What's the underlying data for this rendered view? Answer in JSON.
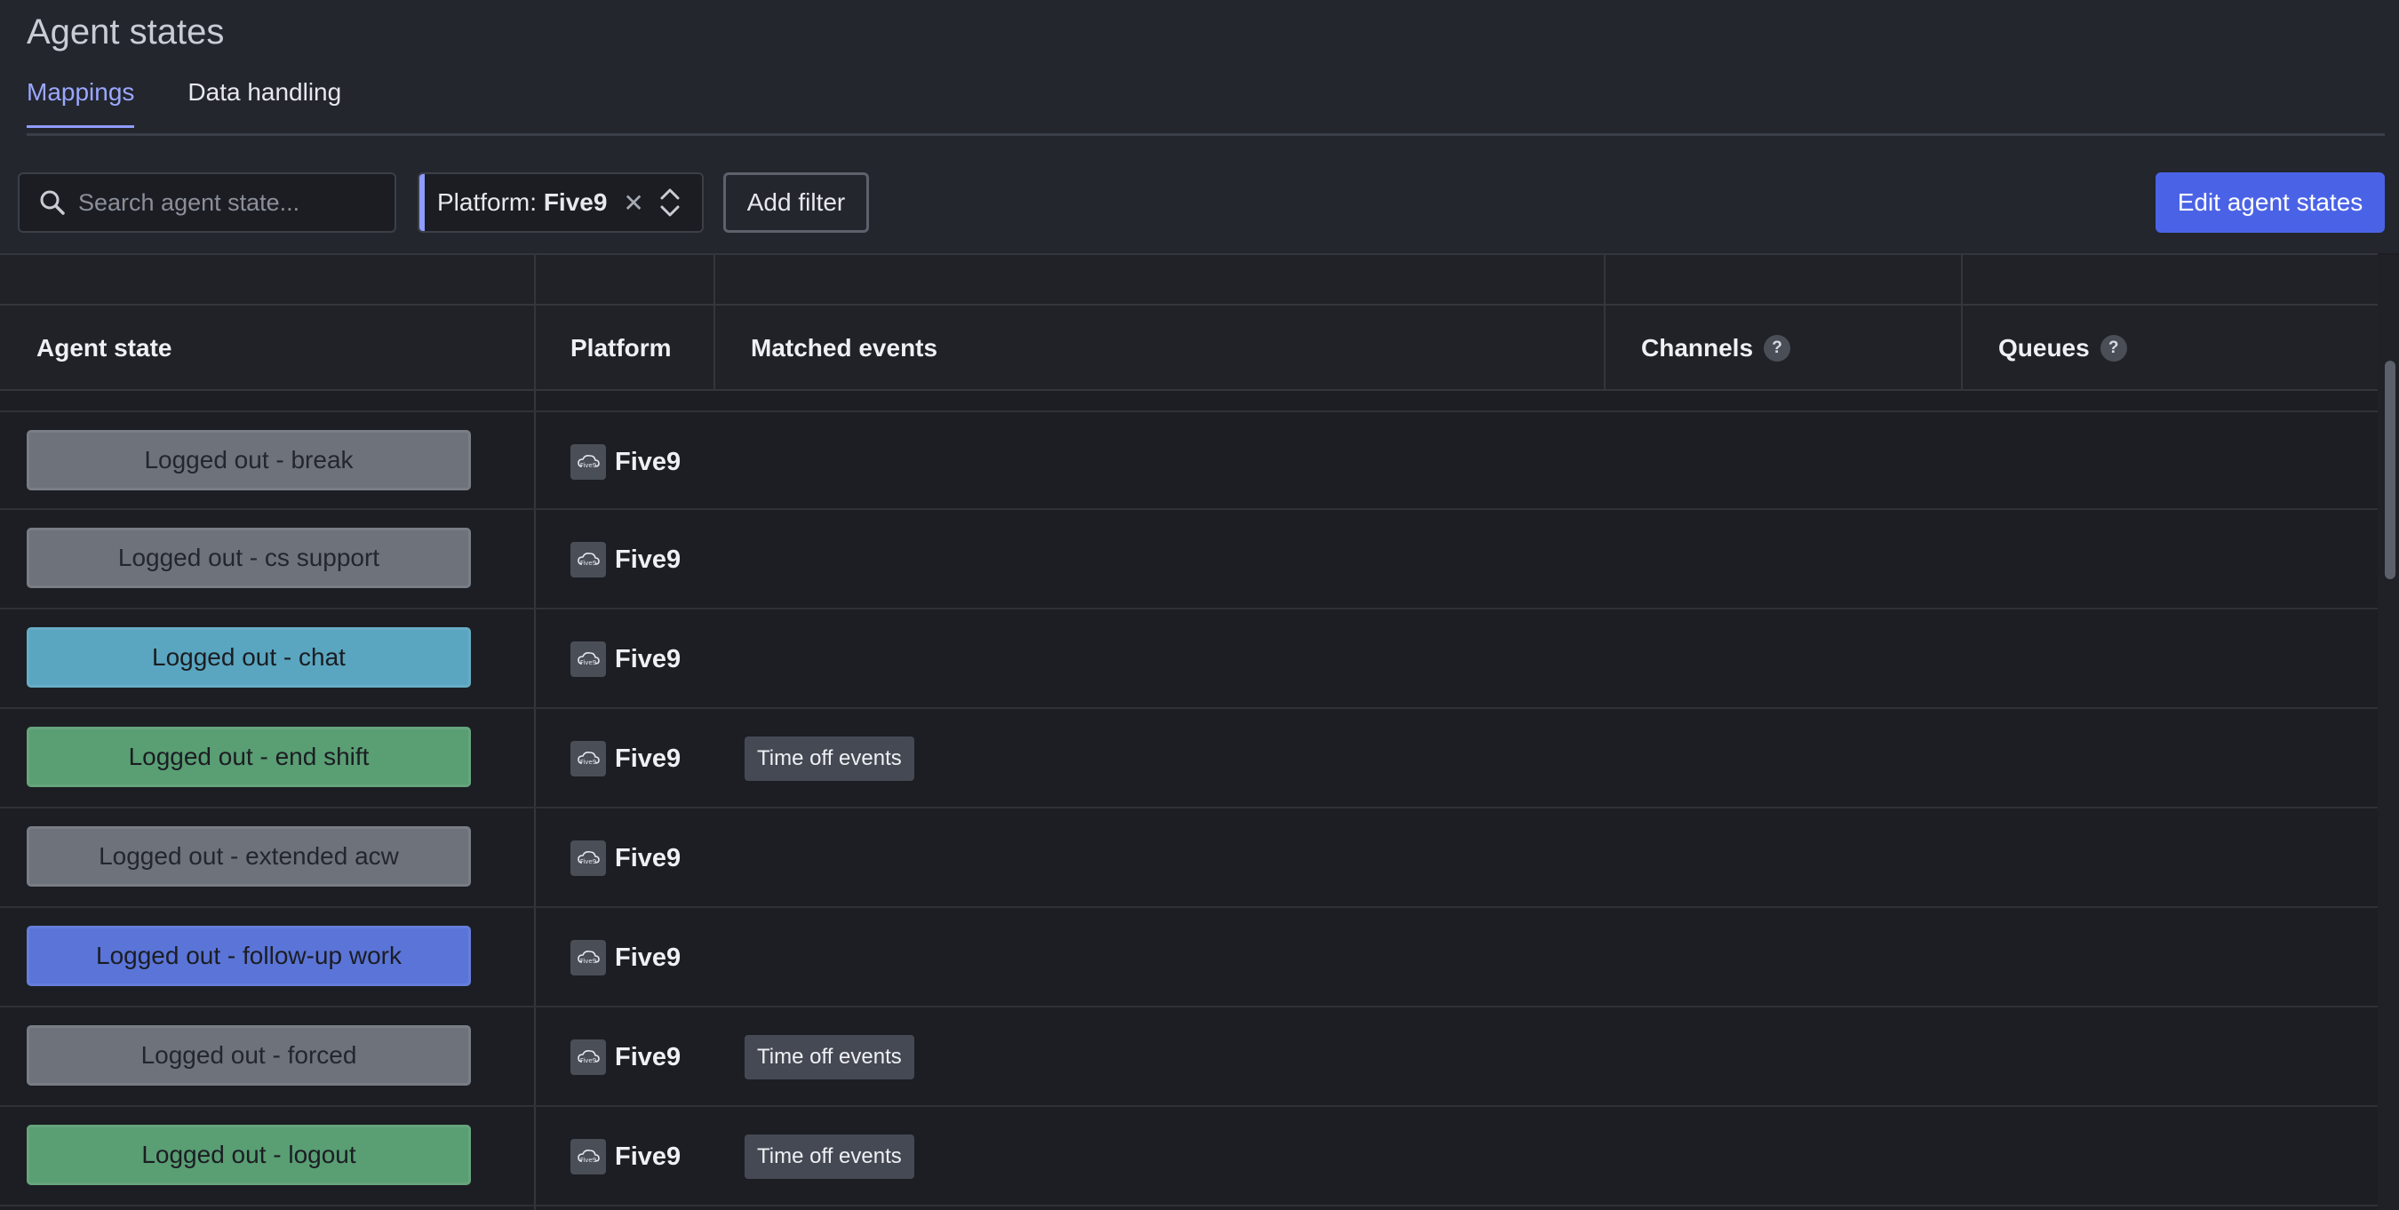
{
  "page": {
    "title": "Agent states",
    "tabs": [
      {
        "label": "Mappings",
        "active": true
      },
      {
        "label": "Data handling",
        "active": false
      }
    ]
  },
  "toolbar": {
    "search_placeholder": "Search agent state...",
    "filter_chip": {
      "prefix": "Platform: ",
      "value": "Five9"
    },
    "add_filter_label": "Add filter",
    "edit_button_label": "Edit agent states"
  },
  "table": {
    "columns": {
      "agent_state": "Agent state",
      "platform": "Platform",
      "matched_events": "Matched events",
      "channels": "Channels",
      "queues": "Queues"
    },
    "help_mark": "?",
    "rows": [
      {
        "state": "Logged out - break",
        "color": "#6e727b",
        "text_color": "#23262d",
        "platform": "Five9",
        "event": ""
      },
      {
        "state": "Logged out - cs support",
        "color": "#6e727b",
        "text_color": "#23262d",
        "platform": "Five9",
        "event": ""
      },
      {
        "state": "Logged out - chat",
        "color": "#5aa6c0",
        "text_color": "#1b1d22",
        "platform": "Five9",
        "event": ""
      },
      {
        "state": "Logged out - end shift",
        "color": "#5a9e74",
        "text_color": "#1b1d22",
        "platform": "Five9",
        "event": "Time off events"
      },
      {
        "state": "Logged out - extended acw",
        "color": "#6e727b",
        "text_color": "#23262d",
        "platform": "Five9",
        "event": ""
      },
      {
        "state": "Logged out - follow-up work",
        "color": "#5a74d8",
        "text_color": "#1b1d22",
        "platform": "Five9",
        "event": ""
      },
      {
        "state": "Logged out - forced",
        "color": "#6e727b",
        "text_color": "#23262d",
        "platform": "Five9",
        "event": "Time off events"
      },
      {
        "state": "Logged out - logout",
        "color": "#5a9e74",
        "text_color": "#1b1d22",
        "platform": "Five9",
        "event": "Time off events"
      }
    ]
  },
  "colors": {
    "accent": "#8f9cff",
    "primary_button": "#4a63e6",
    "background": "#1c1e23"
  }
}
